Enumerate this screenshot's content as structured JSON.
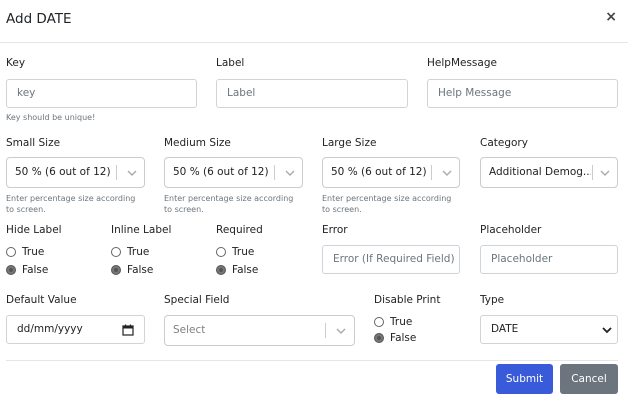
{
  "modal": {
    "title": "Add DATE",
    "close": "×"
  },
  "fields": {
    "key": {
      "label": "Key",
      "placeholder": "key",
      "help": "Key should be unique!"
    },
    "label": {
      "label": "Label",
      "placeholder": "Label"
    },
    "help_message": {
      "label": "HelpMessage",
      "placeholder": "Help Message"
    },
    "small_size": {
      "label": "Small Size",
      "value": "50 % (6 out of 12)",
      "help1": "Enter percentage size according",
      "help2": "to screen."
    },
    "medium_size": {
      "label": "Medium Size",
      "value": "50 % (6 out of 12)",
      "help1": "Enter percentage size according",
      "help2": "to screen."
    },
    "large_size": {
      "label": "Large Size",
      "value": "50 % (6 out of 12)",
      "help1": "Enter percentage size according",
      "help2": "to screen."
    },
    "category": {
      "label": "Category",
      "value": "Additional Demog..."
    },
    "hide_label": {
      "label": "Hide Label",
      "options": [
        "True",
        "False"
      ],
      "selected": "False"
    },
    "inline_label": {
      "label": "Inline Label",
      "options": [
        "True",
        "False"
      ],
      "selected": "False"
    },
    "required": {
      "label": "Required",
      "options": [
        "True",
        "False"
      ],
      "selected": "False"
    },
    "error": {
      "label": "Error",
      "placeholder": "Error (If Required Field)"
    },
    "placeholder": {
      "label": "Placeholder",
      "placeholder": "Placeholder"
    },
    "default_value": {
      "label": "Default Value",
      "placeholder": "dd/mm/yyyy"
    },
    "special_field": {
      "label": "Special Field",
      "placeholder": "Select"
    },
    "disable_print": {
      "label": "Disable Print",
      "options": [
        "True",
        "False"
      ],
      "selected": "False"
    },
    "type": {
      "label": "Type",
      "value": "DATE"
    }
  },
  "buttons": {
    "submit": "Submit",
    "cancel": "Cancel"
  },
  "colors": {
    "primary": "#3a5bd9",
    "secondary": "#6c757d",
    "border": "#ced4da"
  }
}
